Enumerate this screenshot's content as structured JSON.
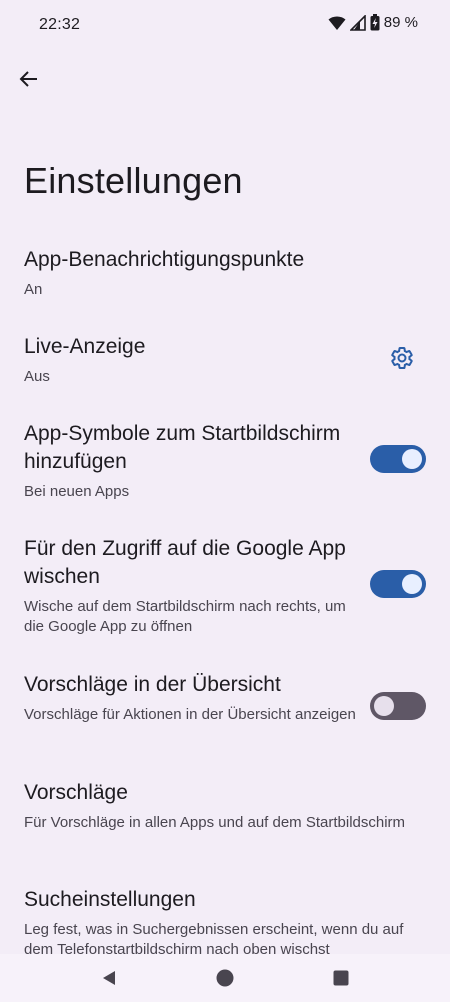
{
  "status": {
    "time": "22:32",
    "battery": "89 %"
  },
  "header": {
    "title": "Einstellungen"
  },
  "settings": [
    {
      "title": "App-Benachrichtigungspunkte",
      "summary": "An"
    },
    {
      "title": "Live-Anzeige",
      "summary": "Aus"
    },
    {
      "title": "App-Symbole zum Startbildschirm hinzufügen",
      "summary": "Bei neuen Apps",
      "checked": true
    },
    {
      "title": "Für den Zugriff auf die Google App wischen",
      "summary": "Wische auf dem Startbildschirm nach rechts, um die Google App zu öffnen",
      "checked": true
    },
    {
      "title": "Vorschläge in der Übersicht",
      "summary": "Vorschläge für Aktionen in der Übersicht anzeigen",
      "checked": false
    },
    {
      "title": "Vorschläge",
      "summary": "Für Vorschläge in allen Apps und auf dem Startbildschirm"
    },
    {
      "title": "Sucheinstellungen",
      "summary": "Leg fest, was in Suchergebnissen erscheint, wenn du auf dem Telefonstartbildschirm nach oben wischst"
    }
  ],
  "icons": {
    "back": "arrow-back-icon",
    "gear": "gear-icon",
    "wifi": "wifi-icon",
    "signal": "signal-icon",
    "battery": "battery-charging-icon"
  },
  "colors": {
    "background": "#f3edf7",
    "accent": "#2a5ea8",
    "toggle_off": "#5f5766"
  }
}
